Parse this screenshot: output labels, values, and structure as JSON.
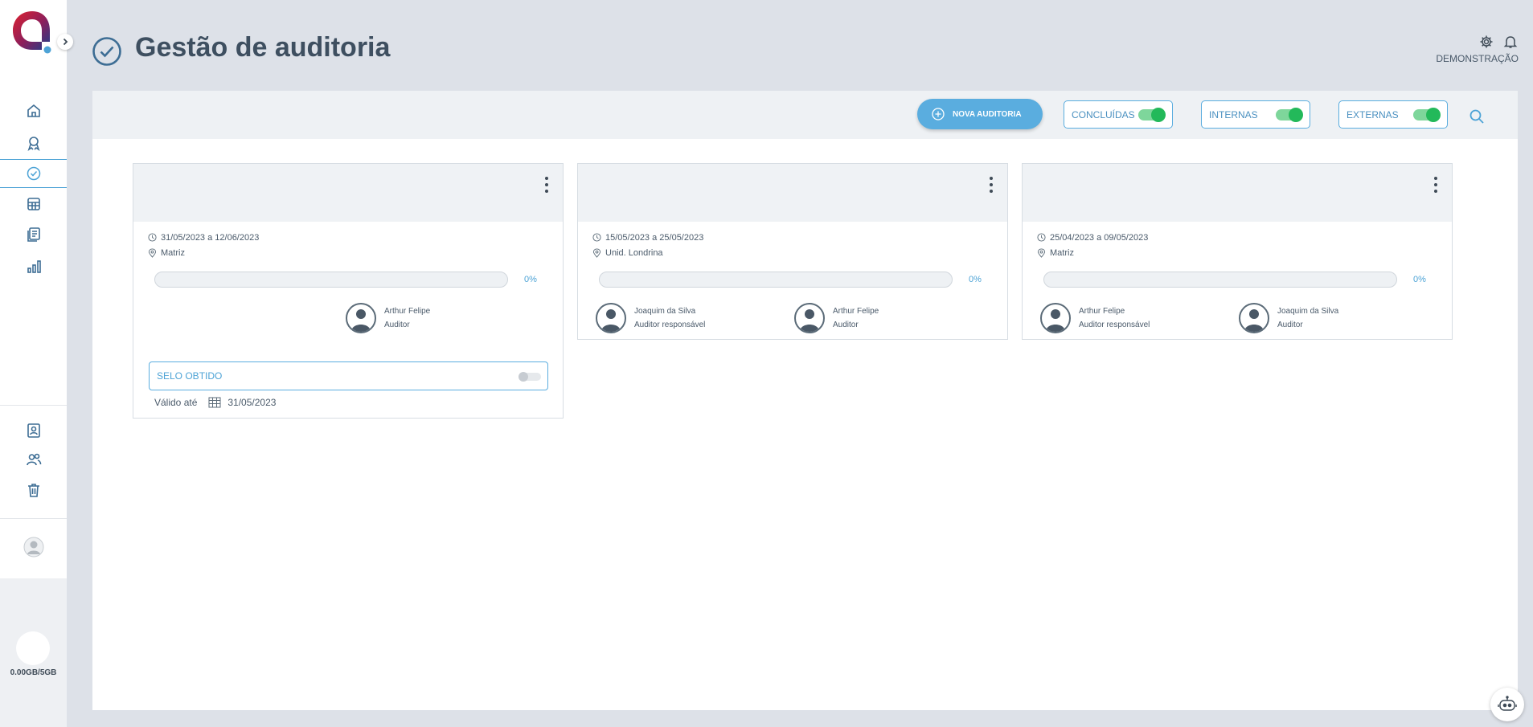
{
  "header": {
    "title": "Gestão de auditoria",
    "company": "DEMONSTRAÇÃO"
  },
  "sidebar": {
    "items": [
      {
        "icon": "home-icon"
      },
      {
        "icon": "award-icon"
      },
      {
        "icon": "check-circle-icon",
        "active": true
      },
      {
        "icon": "calendar-grid-icon"
      },
      {
        "icon": "documents-icon"
      },
      {
        "icon": "bar-chart-icon"
      },
      {
        "icon": "contact-card-icon"
      },
      {
        "icon": "users-icon"
      },
      {
        "icon": "trash-icon"
      }
    ],
    "storage": "0.00GB/5GB"
  },
  "toolbar": {
    "new_audit_label": "NOVA AUDITORIA",
    "filters": [
      {
        "label": "CONCLUÍDAS",
        "on": true
      },
      {
        "label": "INTERNAS",
        "on": true
      },
      {
        "label": "EXTERNAS",
        "on": true
      }
    ]
  },
  "cards": [
    {
      "period": "31/05/2023 a 12/06/2023",
      "location": "Matriz",
      "progress": "0%",
      "people": [
        {
          "name": "Arthur Felipe",
          "role": "Auditor"
        }
      ],
      "seal_label": "SELO OBTIDO",
      "valid_label": "Válido até",
      "valid_date": "31/05/2023"
    },
    {
      "period": "15/05/2023 a 25/05/2023",
      "location": "Unid. Londrina",
      "progress": "0%",
      "people": [
        {
          "name": "Joaquim da Silva",
          "role": "Auditor responsável"
        },
        {
          "name": "Arthur Felipe",
          "role": "Auditor"
        }
      ]
    },
    {
      "period": "25/04/2023 a 09/05/2023",
      "location": "Matriz",
      "progress": "0%",
      "people": [
        {
          "name": "Arthur Felipe",
          "role": "Auditor responsável"
        },
        {
          "name": "Joaquim da Silva",
          "role": "Auditor"
        }
      ]
    }
  ],
  "colors": {
    "accent": "#5aaddf",
    "toggle_on": "#23b95a",
    "title": "#3e4f60",
    "background": "#dde1e8"
  }
}
